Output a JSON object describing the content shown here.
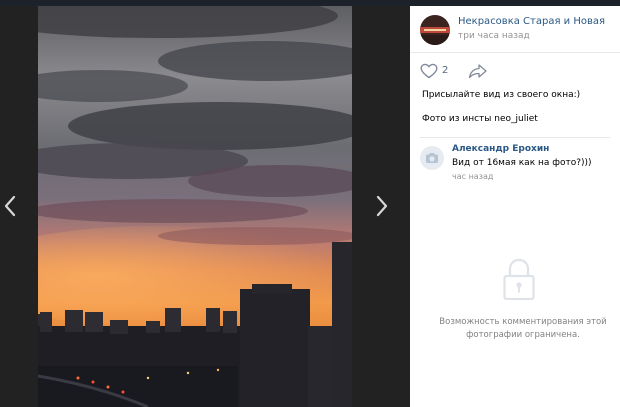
{
  "group": {
    "name": "Некрасовка Старая и Новая",
    "time": "три часа назад"
  },
  "post": {
    "likes": "2",
    "text_line1": "Присылайте вид из своего окна:)",
    "text_line2": "Фото из инсты neo_juliet"
  },
  "comment": {
    "author": "Александр Ерохин",
    "text": "Вид от 16мая как на фото?)))",
    "time": "час назад"
  },
  "comments_restricted": {
    "line1": "Возможность комментирования этой",
    "line2": "фотографии ограничена."
  },
  "icons": {
    "prev": "chevron-left-icon",
    "next": "chevron-right-icon",
    "like": "heart-icon",
    "share": "share-arrow-icon",
    "lock": "lock-icon",
    "camera": "camera-icon"
  },
  "colors": {
    "link": "#2a5885",
    "muted": "#939393",
    "viewer_bg": "#222222"
  }
}
